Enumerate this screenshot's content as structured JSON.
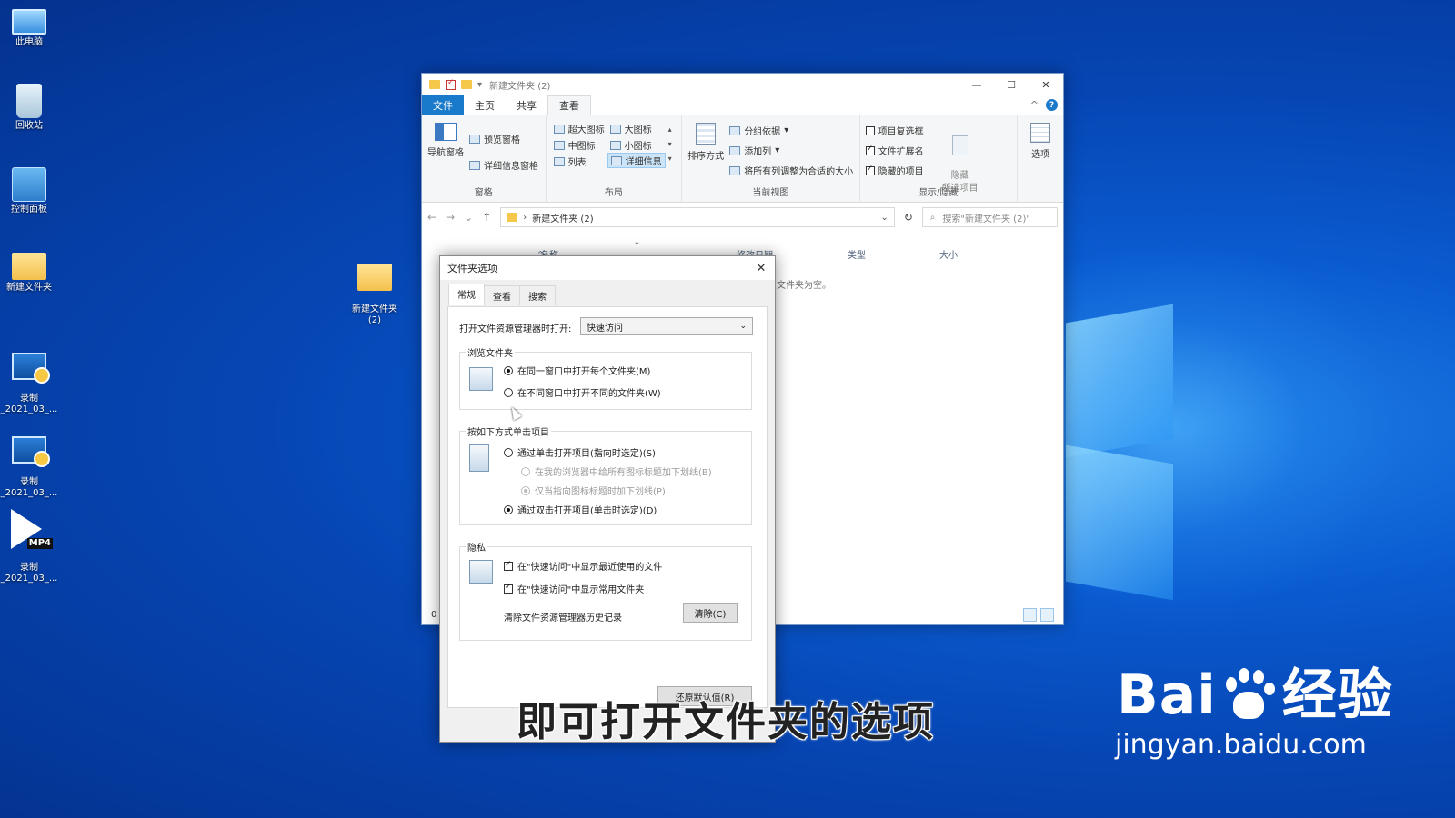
{
  "desktop": {
    "icons": [
      {
        "label": "此电脑",
        "icon": "computer-icon"
      },
      {
        "label": "回收站",
        "icon": "recycle-bin-icon"
      },
      {
        "label": "控制面板",
        "icon": "control-panel-icon"
      },
      {
        "label": "新建文件夹",
        "icon": "folder-icon"
      },
      {
        "label": "录制\n_2021_03_...",
        "icon": "video-file-icon"
      },
      {
        "label": "录制\n_2021_03_...",
        "icon": "video-file-icon"
      },
      {
        "label": "录制\n_2021_03_...",
        "icon": "mp4-file-icon"
      },
      {
        "label": "新建文件夹\n(2)",
        "icon": "folder-icon"
      }
    ],
    "mp4_badge": "MP4"
  },
  "explorer": {
    "title": "新建文件夹 (2)",
    "window_controls": {
      "minimize": "—",
      "maximize": "☐",
      "close": "✕"
    },
    "ribbon_tabs": [
      "文件",
      "主页",
      "共享",
      "查看"
    ],
    "active_tab": "查看",
    "panes_group": {
      "name": "窗格",
      "nav_pane": "导航窗格",
      "preview_pane": "预览窗格",
      "details_pane": "详细信息窗格"
    },
    "layout_group": {
      "name": "布局",
      "items": [
        "超大图标",
        "大图标",
        "中图标",
        "小图标",
        "列表",
        "详细信息"
      ],
      "selected": "详细信息"
    },
    "current_view_group": {
      "name": "当前视图",
      "sort_by": "排序方式",
      "group_by": "分组依据",
      "add_columns": "添加列",
      "size_all_columns": "将所有列调整为合适的大小"
    },
    "show_hide_group": {
      "name": "显示/隐藏",
      "item_checkboxes": {
        "label": "项目复选框",
        "checked": false
      },
      "file_extensions": {
        "label": "文件扩展名",
        "checked": true
      },
      "hidden_items": {
        "label": "隐藏的项目",
        "checked": true
      },
      "hide_selected": "隐藏\n所选项目"
    },
    "options_button": "选项",
    "address": "新建文件夹 (2)",
    "search_placeholder": "搜索\"新建文件夹 (2)\"",
    "columns": [
      "名称",
      "修改日期",
      "类型",
      "大小"
    ],
    "empty_message": "文件夹为空。",
    "status_count": "0"
  },
  "dialog": {
    "title": "文件夹选项",
    "tabs": [
      "常规",
      "查看",
      "搜索"
    ],
    "active_tab": "常规",
    "open_explorer_label": "打开文件资源管理器时打开:",
    "open_explorer_value": "快速访问",
    "browse_group": {
      "legend": "浏览文件夹",
      "same_window": {
        "label": "在同一窗口中打开每个文件夹(M)",
        "selected": true
      },
      "new_window": {
        "label": "在不同窗口中打开不同的文件夹(W)",
        "selected": false
      }
    },
    "click_group": {
      "legend": "按如下方式单击项目",
      "single_click": {
        "label": "通过单击打开项目(指向时选定)(S)",
        "selected": false
      },
      "underline_browser": {
        "label": "在我的浏览器中给所有图标标题加下划线(B)",
        "selected": false
      },
      "underline_point": {
        "label": "仅当指向图标标题时加下划线(P)",
        "selected": true
      },
      "double_click": {
        "label": "通过双击打开项目(单击时选定)(D)",
        "selected": true
      }
    },
    "privacy_group": {
      "legend": "隐私",
      "recent_files": {
        "label": "在\"快速访问\"中显示最近使用的文件",
        "checked": true
      },
      "frequent_folders": {
        "label": "在\"快速访问\"中显示常用文件夹",
        "checked": true
      },
      "clear_label": "清除文件资源管理器历史记录",
      "clear_button": "清除(C)"
    },
    "restore_button": "还原默认值(R)"
  },
  "caption": "即可打开文件夹的选项",
  "watermark": {
    "brand_left": "Bai",
    "brand_right": "经验",
    "url": "jingyan.baidu.com"
  }
}
